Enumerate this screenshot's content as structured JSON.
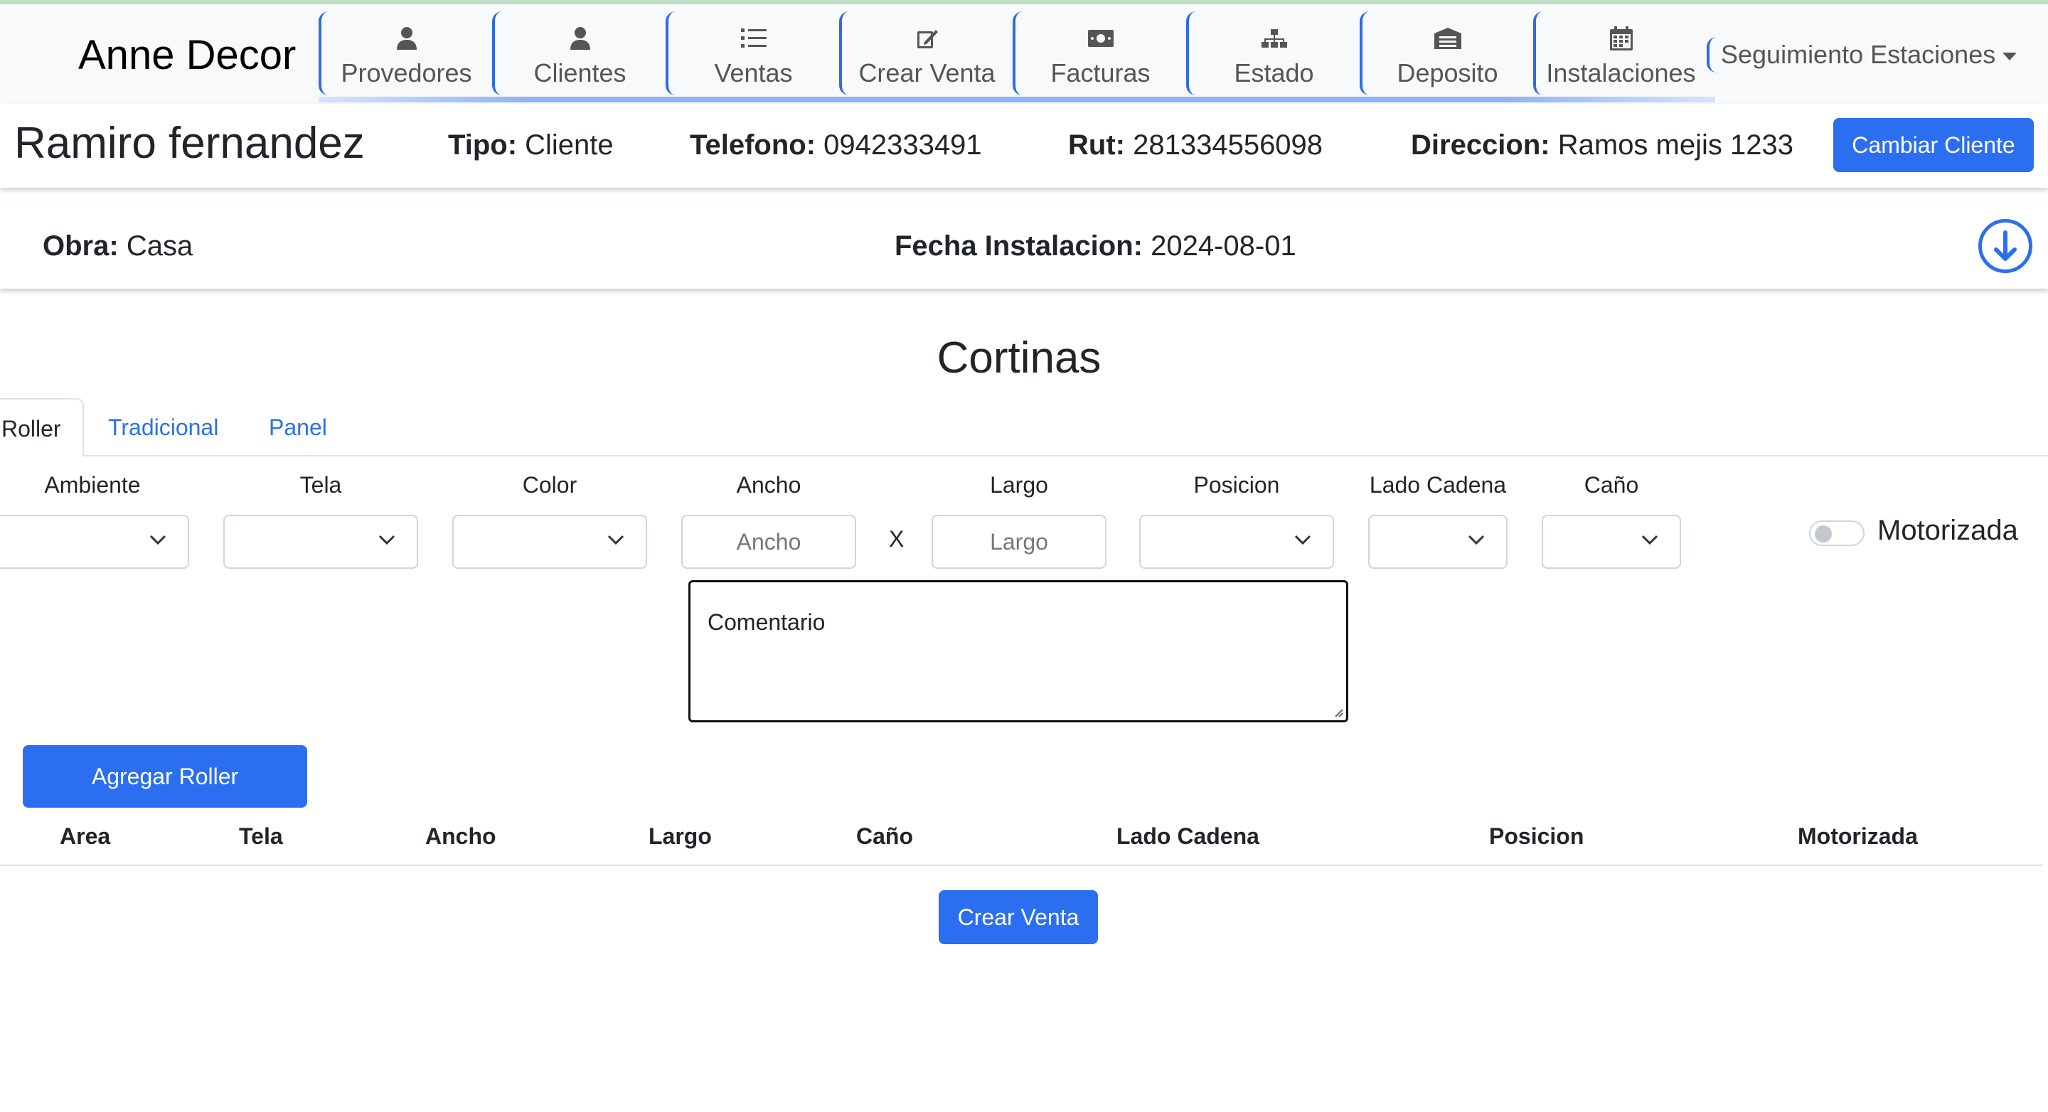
{
  "navbar": {
    "brand": "Anne Decor",
    "items": [
      {
        "label": "Provedores",
        "icon": "person-icon"
      },
      {
        "label": "Clientes",
        "icon": "person-icon"
      },
      {
        "label": "Ventas",
        "icon": "list-icon"
      },
      {
        "label": "Crear Venta",
        "icon": "edit-icon"
      },
      {
        "label": "Facturas",
        "icon": "money-icon"
      },
      {
        "label": "Estado",
        "icon": "sitemap-icon"
      },
      {
        "label": "Deposito",
        "icon": "warehouse-icon"
      },
      {
        "label": "Instalaciones",
        "icon": "calendar-icon"
      }
    ],
    "dropdown_label": "Seguimiento Estaciones"
  },
  "client": {
    "name": "Ramiro fernandez",
    "tipo_label": "Tipo:",
    "tipo_value": "Cliente",
    "telefono_label": "Telefono:",
    "telefono_value": "0942333491",
    "rut_label": "Rut:",
    "rut_value": "281334556098",
    "direccion_label": "Direccion:",
    "direccion_value": "Ramos mejis 1233",
    "change_button": "Cambiar Cliente"
  },
  "obra": {
    "obra_label": "Obra:",
    "obra_value": "Casa",
    "fecha_label": "Fecha Instalacion:",
    "fecha_value": "2024-08-01"
  },
  "cortinas": {
    "title": "Cortinas",
    "tabs": [
      "Roller",
      "Tradicional",
      "Panel"
    ],
    "active_tab": "Roller",
    "fields": {
      "ambiente": "Ambiente",
      "tela": "Tela",
      "color": "Color",
      "ancho": "Ancho",
      "largo": "Largo",
      "posicion": "Posicion",
      "lado_cadena": "Lado Cadena",
      "cano": "Caño"
    },
    "ancho_placeholder": "Ancho",
    "largo_placeholder": "Largo",
    "separator": "X",
    "motorizada_label": "Motorizada",
    "motorizada_on": false,
    "comentario_placeholder": "Comentario",
    "add_button": "Agregar Roller"
  },
  "table": {
    "columns": [
      "Area",
      "Tela",
      "Ancho",
      "Largo",
      "Caño",
      "Lado Cadena",
      "Posicion",
      "Motorizada"
    ],
    "rows": []
  },
  "footer": {
    "create_button": "Crear Venta"
  },
  "colors": {
    "primary": "#2b6ff0",
    "nav_accent": "#2e6be6",
    "nav_bg": "#f8f9fa"
  }
}
